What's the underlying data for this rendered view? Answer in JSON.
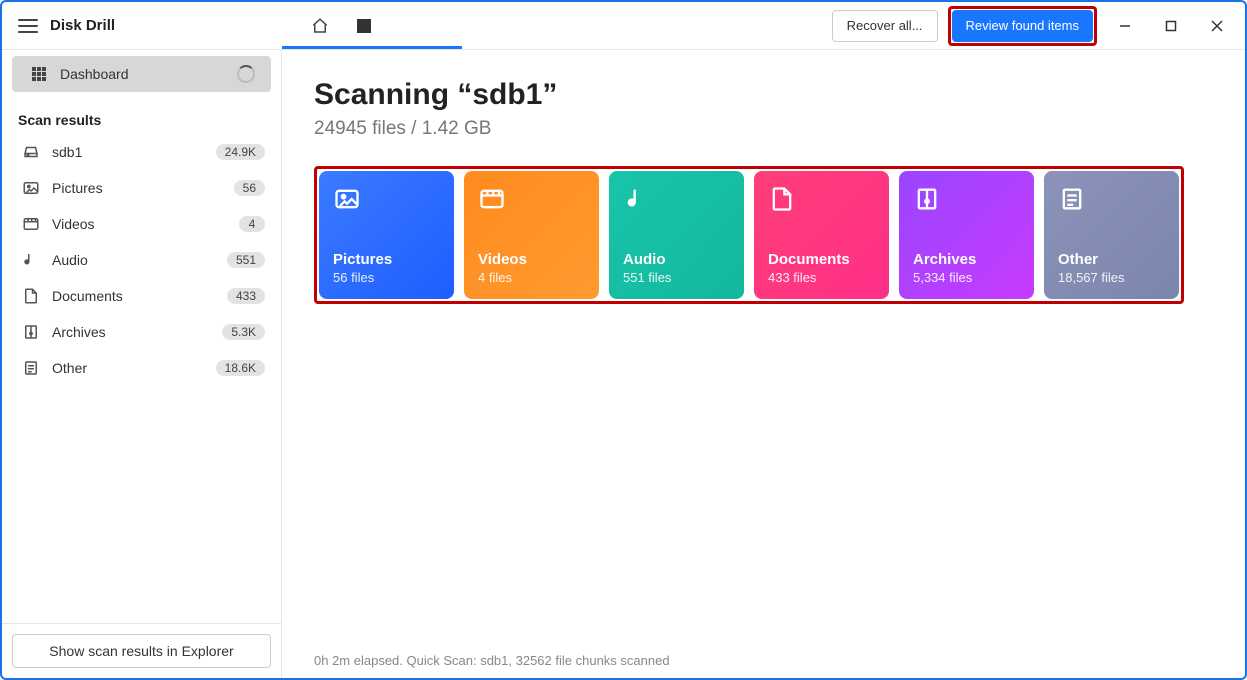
{
  "app": {
    "name": "Disk Drill"
  },
  "toolbar": {
    "recover_label": "Recover all...",
    "review_label": "Review found items"
  },
  "sidebar": {
    "dashboard_label": "Dashboard",
    "heading": "Scan results",
    "items": [
      {
        "label": "sdb1",
        "count": "24.9K"
      },
      {
        "label": "Pictures",
        "count": "56"
      },
      {
        "label": "Videos",
        "count": "4"
      },
      {
        "label": "Audio",
        "count": "551"
      },
      {
        "label": "Documents",
        "count": "433"
      },
      {
        "label": "Archives",
        "count": "5.3K"
      },
      {
        "label": "Other",
        "count": "18.6K"
      }
    ],
    "footer_button": "Show scan results in Explorer"
  },
  "main": {
    "title": "Scanning “sdb1”",
    "subtitle": "24945 files / 1.42 GB",
    "cards": [
      {
        "title": "Pictures",
        "count": "56 files"
      },
      {
        "title": "Videos",
        "count": "4 files"
      },
      {
        "title": "Audio",
        "count": "551 files"
      },
      {
        "title": "Documents",
        "count": "433 files"
      },
      {
        "title": "Archives",
        "count": "5,334 files"
      },
      {
        "title": "Other",
        "count": "18,567 files"
      }
    ],
    "status": "0h 2m elapsed. Quick Scan: sdb1, 32562 file chunks scanned"
  }
}
